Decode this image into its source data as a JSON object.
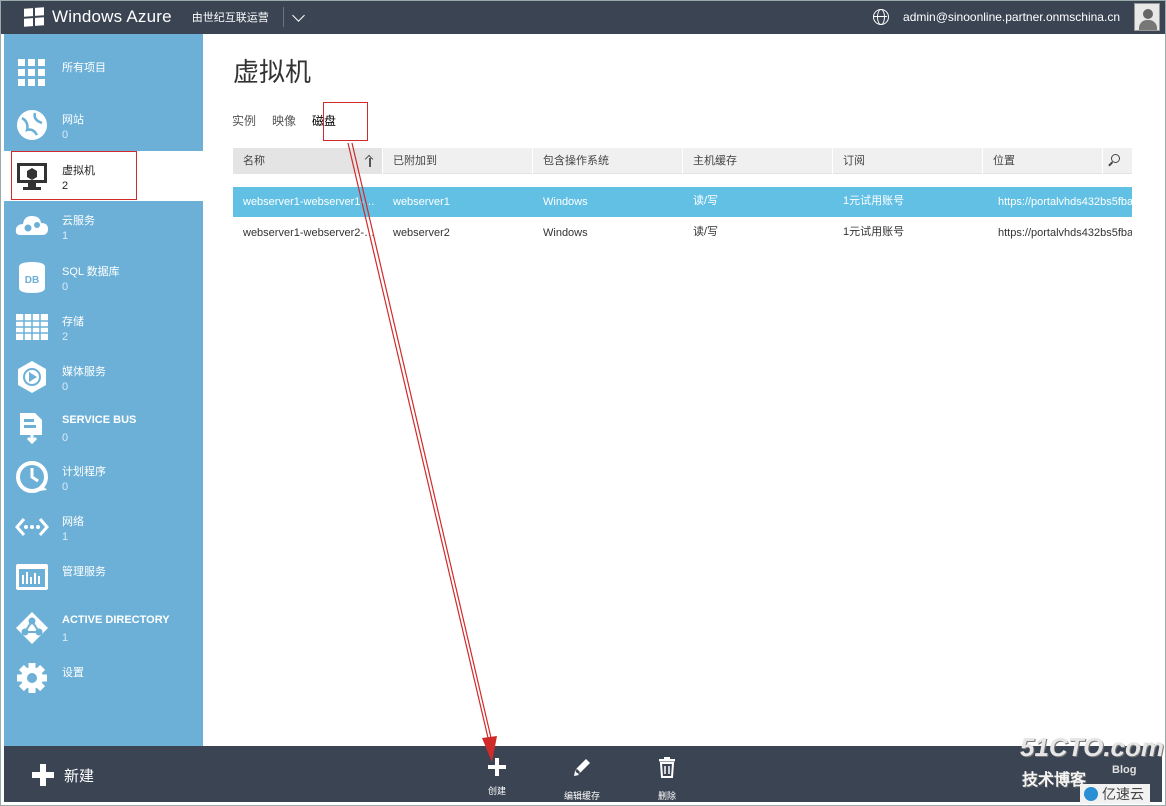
{
  "header": {
    "brand": "Windows Azure",
    "operator": "由世纪互联运营",
    "account": "admin@sinoonline.partner.onmschina.cn"
  },
  "sidebar": {
    "items": [
      {
        "label": "所有项目",
        "count": "",
        "icon": "grid-icon"
      },
      {
        "label": "网站",
        "count": "0",
        "icon": "website-globe-icon"
      },
      {
        "label": "虚拟机",
        "count": "2",
        "icon": "virtual-machine-icon",
        "active": true
      },
      {
        "label": "云服务",
        "count": "1",
        "icon": "cloud-services-icon"
      },
      {
        "label": "SQL 数据库",
        "count": "0",
        "icon": "sql-database-icon"
      },
      {
        "label": "存储",
        "count": "2",
        "icon": "storage-table-icon"
      },
      {
        "label": "媒体服务",
        "count": "0",
        "icon": "media-play-icon"
      },
      {
        "label": "SERVICE BUS",
        "count": "0",
        "icon": "service-bus-icon"
      },
      {
        "label": "计划程序",
        "count": "0",
        "icon": "scheduler-clock-icon"
      },
      {
        "label": "网络",
        "count": "1",
        "icon": "network-icon"
      },
      {
        "label": "管理服务",
        "count": "",
        "icon": "management-services-icon"
      },
      {
        "label": "ACTIVE DIRECTORY",
        "count": "1",
        "icon": "active-directory-icon"
      },
      {
        "label": "设置",
        "count": "",
        "icon": "gear-icon"
      }
    ]
  },
  "main": {
    "title": "虚拟机",
    "tabs": [
      "实例",
      "映像",
      "磁盘"
    ],
    "active_tab": "磁盘",
    "table": {
      "columns": [
        "名称",
        "已附加到",
        "包含操作系统",
        "主机缓存",
        "订阅",
        "位置"
      ],
      "rows": [
        [
          "webserver1-webserver1-0-...",
          "webserver1",
          "Windows",
          "读/写",
          "1元试用账号",
          "https://portalvhds432bs5fba"
        ],
        [
          "webserver1-webserver2-0-...",
          "webserver2",
          "Windows",
          "读/写",
          "1元试用账号",
          "https://portalvhds432bs5fba"
        ]
      ]
    }
  },
  "commandbar": {
    "new_label": "新建",
    "commands": [
      {
        "label": "创建",
        "icon": "plus-icon"
      },
      {
        "label": "编辑缓存",
        "icon": "pencil-icon"
      },
      {
        "label": "删除",
        "icon": "trash-icon"
      }
    ]
  },
  "watermark": {
    "line1": "51CTO.com",
    "line2": "技术博客",
    "line3": "Blog",
    "line4": "亿速云"
  },
  "colors": {
    "topbar": "#3b4453",
    "sidebar": "#6cb0d7",
    "selected_row": "#62c0e5",
    "annotation": "#d12a2a"
  }
}
